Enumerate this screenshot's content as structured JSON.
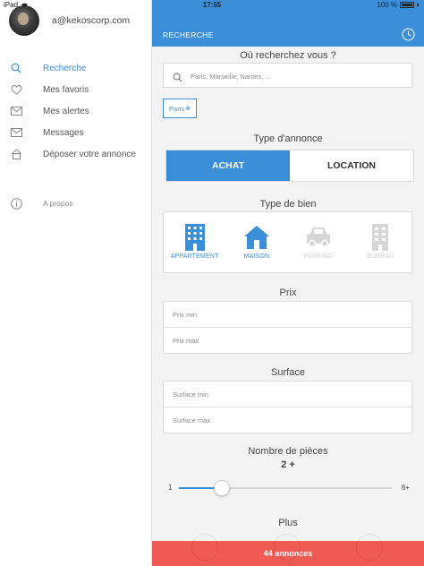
{
  "status_bar": {
    "device": "iPad",
    "time": "17:55",
    "battery": "100 %"
  },
  "sidebar": {
    "email": "a@kekoscorp.com",
    "items": [
      {
        "label": "Recherche",
        "icon": "search-icon",
        "active": true
      },
      {
        "label": "Mes favoris",
        "icon": "heart-icon",
        "active": false
      },
      {
        "label": "Mes alertes",
        "icon": "envelope-icon",
        "active": false
      },
      {
        "label": "Messages",
        "icon": "envelope-icon",
        "active": false
      },
      {
        "label": "Déposer votre annonce",
        "icon": "house-icon",
        "active": false
      }
    ],
    "about": {
      "label": "A propos",
      "icon": "info-icon"
    }
  },
  "header": {
    "title": "RECHERCHE",
    "icon": "clock-icon"
  },
  "colors": {
    "accent": "#3b8fd9",
    "cta": "#ef5a54",
    "disabled": "#d0d0d0"
  },
  "search": {
    "title": "Où recherchez vous ?",
    "placeholder": "Paris, Marseille, Nantes, ...",
    "tag": "Paris",
    "tag_remove": "⊗"
  },
  "annonce": {
    "title": "Type d'annonce",
    "options": [
      "ACHAT",
      "LOCATION"
    ],
    "selected": "ACHAT"
  },
  "bien": {
    "title": "Type de bien",
    "options": [
      {
        "label": "APPARTEMENT",
        "icon": "building-icon",
        "selected": true
      },
      {
        "label": "MAISON",
        "icon": "house-icon",
        "selected": true
      },
      {
        "label": "PARKING",
        "icon": "car-icon",
        "selected": false
      },
      {
        "label": "BUREAU",
        "icon": "office-icon",
        "selected": false
      }
    ]
  },
  "prix": {
    "title": "Prix",
    "min_placeholder": "Prix min",
    "max_placeholder": "Prix max"
  },
  "surface": {
    "title": "Surface",
    "min_placeholder": "Surface min",
    "max_placeholder": "Surface max"
  },
  "pieces": {
    "title": "Nombre de pièces",
    "value": "2 +",
    "min": "1",
    "max": "6+",
    "level_fraction": 0.2
  },
  "plus": {
    "title": "Plus"
  },
  "cta": {
    "label": "44 annonces"
  }
}
